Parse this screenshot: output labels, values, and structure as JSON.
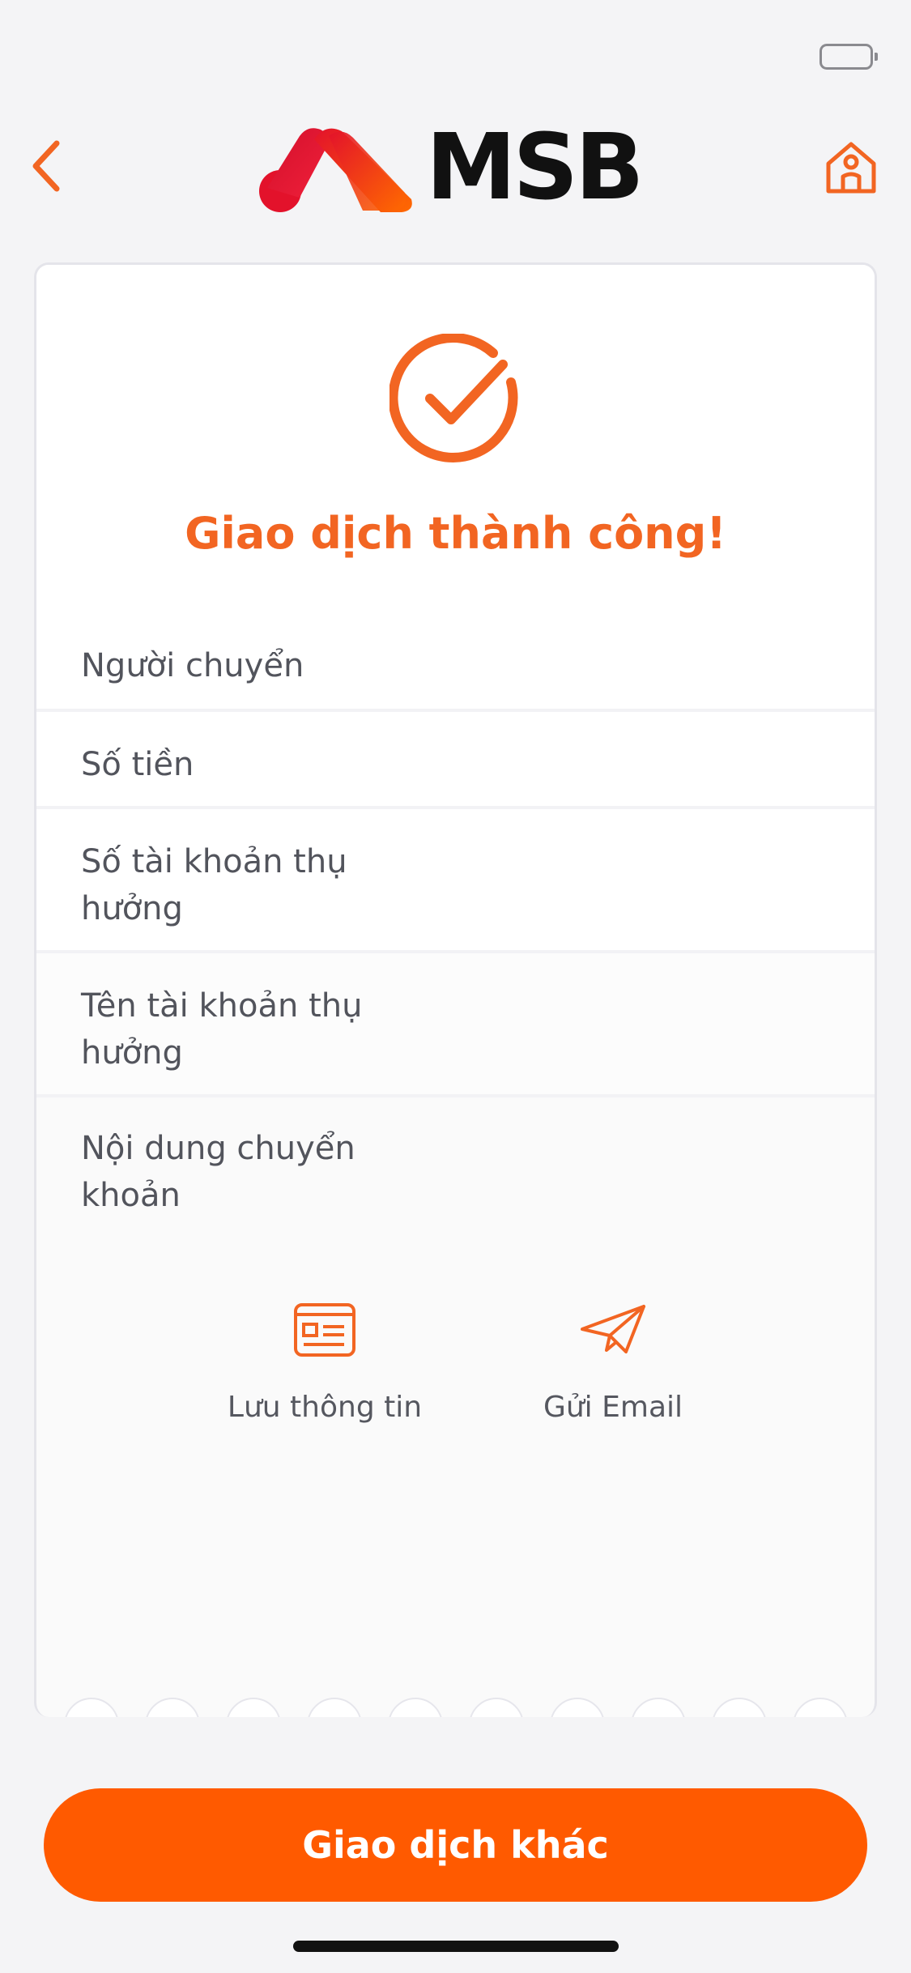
{
  "header": {
    "brand": "MSB",
    "colors": {
      "accent": "#f26522",
      "logo_red": "#e3122b",
      "logo_orange": "#ff5a00"
    }
  },
  "receipt": {
    "title": "Giao dịch thành công!",
    "fields": [
      {
        "label": "Người chuyển",
        "value": ""
      },
      {
        "label": "Số tiền",
        "value": ""
      },
      {
        "label": "Số tài khoản thụ hưởng",
        "value": ""
      },
      {
        "label": "Tên tài khoản thụ hưởng",
        "value": ""
      },
      {
        "label": "Nội dung chuyển khoản",
        "value": ""
      }
    ],
    "actions": {
      "save_label": "Lưu thông tin",
      "save_icon": "id-card-icon",
      "email_label": "Gửi Email",
      "email_icon": "paper-plane-icon"
    }
  },
  "footer": {
    "primary_button_label": "Giao dịch khác"
  }
}
